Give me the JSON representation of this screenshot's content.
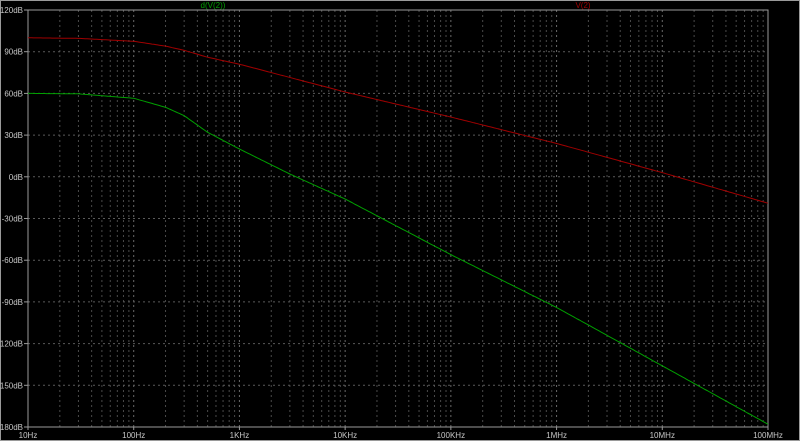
{
  "chart_data": {
    "type": "line",
    "title": "",
    "xlabel": "",
    "ylabel": "",
    "xscale": "log",
    "xlim": [
      10,
      100000000
    ],
    "ylim": [
      -180,
      120
    ],
    "grid": true,
    "x_tick_labels": [
      "10Hz",
      "100Hz",
      "1KHz",
      "10KHz",
      "100KHz",
      "1MHz",
      "10MHz",
      "100MHz"
    ],
    "x_tick_values": [
      10,
      100,
      1000,
      10000,
      100000,
      1000000,
      10000000,
      100000000
    ],
    "y_tick_labels": [
      "120dB",
      "90dB",
      "60dB",
      "30dB",
      "0dB",
      "-30dB",
      "-60dB",
      "-90dB",
      "-120dB",
      "-150dB",
      "-180dB"
    ],
    "y_tick_values": [
      120,
      90,
      60,
      30,
      0,
      -30,
      -60,
      -90,
      -120,
      -150,
      -180
    ],
    "legend_placement": "top",
    "series": [
      {
        "name": "d(V(2))",
        "color": "#00a000",
        "x": [
          10,
          30,
          100,
          200,
          300,
          500,
          1000,
          3000,
          10000,
          100000,
          1000000,
          10000000,
          100000000
        ],
        "y": [
          60,
          59.7,
          56.5,
          50,
          44,
          32,
          20,
          2,
          -16,
          -56,
          -94,
          -136,
          -178
        ]
      },
      {
        "name": "V(2)",
        "color": "#a00000",
        "x": [
          10,
          30,
          100,
          200,
          300,
          500,
          1000,
          10000,
          100000,
          1000000,
          10000000,
          100000000
        ],
        "y": [
          100,
          99.6,
          97.5,
          94,
          91,
          86,
          81,
          61,
          43,
          24,
          3,
          -19
        ]
      }
    ]
  }
}
